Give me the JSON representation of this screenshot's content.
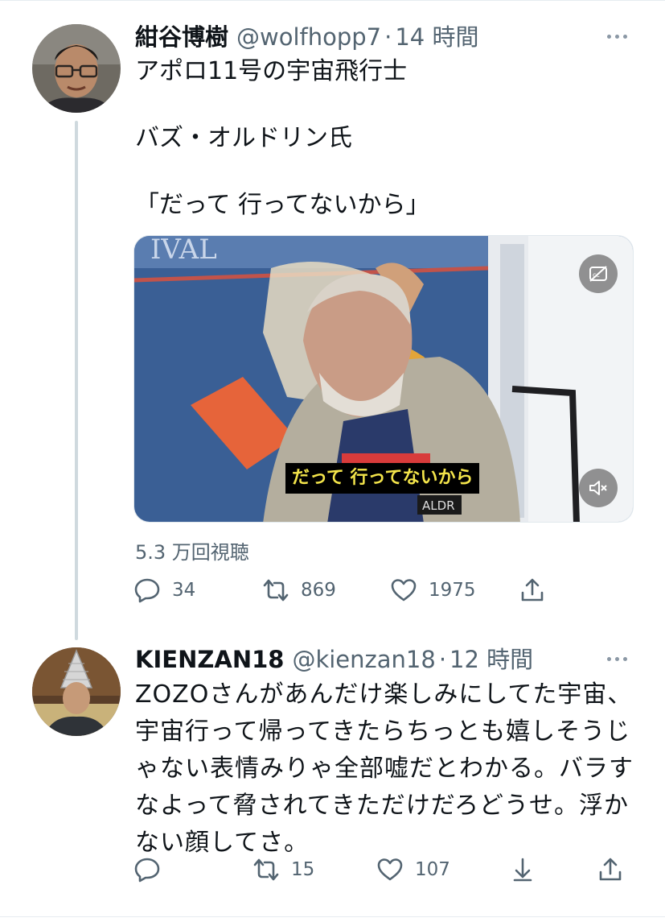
{
  "tweets": [
    {
      "name": "紺谷博樹",
      "handle": "@wolfhopp7",
      "separator": "·",
      "time": "14 時間",
      "text": "アポロ11号の宇宙飛行士\n\nバズ・オルドリン氏\n\n「だって 行ってないから」",
      "media": {
        "subtitle": "だって 行ってないから",
        "caption_button_icon": "closed-captions-off-icon",
        "mute_button_icon": "muted-speaker-icon"
      },
      "views": "5.3 万回視聴",
      "actions": {
        "reply_count": "34",
        "retweet_count": "869",
        "like_count": "1975"
      }
    },
    {
      "name": "KIENZAN18",
      "handle": "@kienzan18",
      "separator": "·",
      "time": "12 時間",
      "text": "ZOZOさんがあんだけ楽しみにしてた宇宙、\n宇宙行って帰ってきたらちっとも嬉しそうじ\nゃない表情みりゃ全部嘘だとわかる。バラす\nなよって脅されてきただけだろどうせ。浮か\nない顔してさ。",
      "actions": {
        "reply_count": "",
        "retweet_count": "15",
        "like_count": "107"
      }
    }
  ],
  "colors": {
    "text_primary": "#0f1419",
    "text_secondary": "#536471",
    "subtitle_yellow": "#f3e44a",
    "thread_line": "#cfd9de"
  }
}
